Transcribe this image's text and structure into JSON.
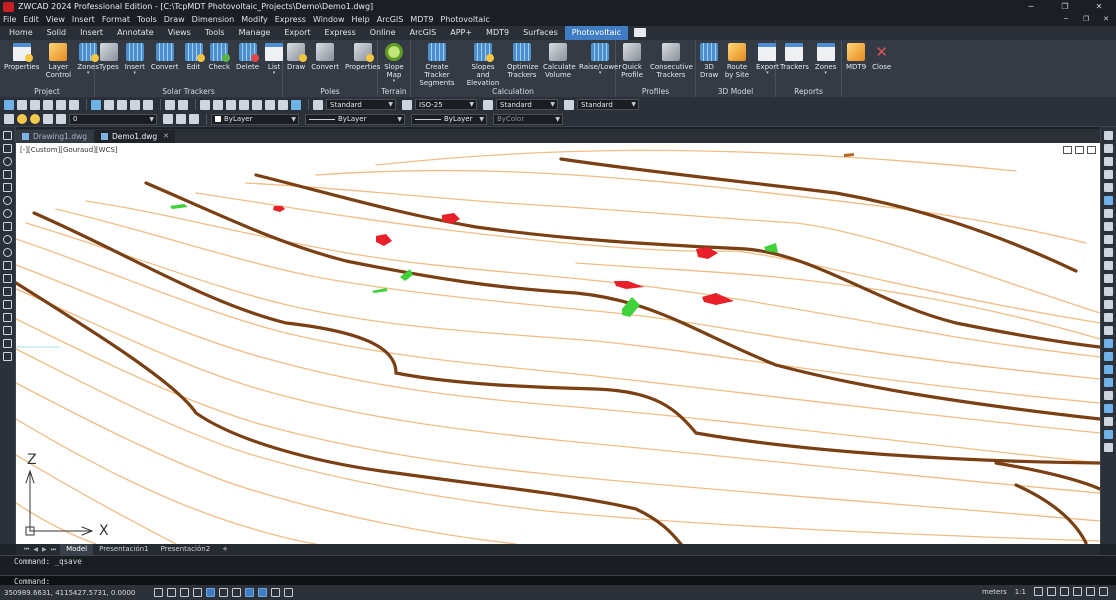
{
  "window": {
    "title": "ZWCAD 2024 Professional Edition - [C:\\TcpMDT Photovoltaic_Projects\\Demo\\Demo1.dwg]",
    "minimize": "─",
    "maximize": "❐",
    "close": "✕"
  },
  "menu": [
    "File",
    "Edit",
    "View",
    "Insert",
    "Format",
    "Tools",
    "Draw",
    "Dimension",
    "Modify",
    "Express",
    "Window",
    "Help",
    "ArcGIS",
    "MDT9",
    "Photovoltaic"
  ],
  "ribbon_tabs": [
    "Home",
    "Solid",
    "Insert",
    "Annotate",
    "Views",
    "Tools",
    "Manage",
    "Export",
    "Express",
    "Online",
    "ArcGIS",
    "APP+",
    "MDT9",
    "Surfaces",
    "Photovoltaic"
  ],
  "active_ribbon_tab": "Photovoltaic",
  "ribbon": {
    "project": {
      "label": "Project",
      "buttons": [
        "Properties",
        "Layer Control",
        "Zones"
      ]
    },
    "trackers": {
      "label": "Solar Trackers",
      "buttons": [
        "Types",
        "Insert",
        "Convert",
        "Edit",
        "Check",
        "Delete",
        "List"
      ]
    },
    "poles": {
      "label": "Poles",
      "buttons": [
        "Draw",
        "Convert",
        "Properties"
      ]
    },
    "terrain": {
      "label": "Terrain",
      "buttons": [
        "Slope Map"
      ]
    },
    "calculation": {
      "label": "Calculation",
      "buttons": [
        "Create Tracker Segments",
        "Slopes and Elevation",
        "Optimize Trackers",
        "Calculate Volume",
        "Raise/Lower"
      ]
    },
    "profiles": {
      "label": "Profiles",
      "buttons": [
        "Quick Profile",
        "Consecutive Trackers"
      ]
    },
    "model3d": {
      "label": "3D Model",
      "buttons": [
        "3D Draw",
        "Route by Site",
        "Export"
      ]
    },
    "reports": {
      "label": "Reports",
      "buttons": [
        "Trackers",
        "Zones"
      ]
    },
    "extra": {
      "buttons": [
        "MDT9",
        "Close"
      ]
    }
  },
  "toolbar": {
    "text_style": "Standard",
    "dim_style": "ISO-25",
    "table_style": "Standard",
    "mleader_style": "Standard",
    "layer": "0",
    "color": "ByLayer",
    "linetype": "ByLayer",
    "lineweight": "ByLayer",
    "plotstyle": "ByColor"
  },
  "doc_tabs": [
    {
      "name": "Drawing1.dwg",
      "active": false
    },
    {
      "name": "Demo1.dwg",
      "active": true
    }
  ],
  "viewport": {
    "label": "[-][Custom][Gouraud][WCS]",
    "axis_x": "X",
    "axis_z": "Z"
  },
  "layout_tabs": [
    {
      "name": "Model",
      "active": true
    },
    {
      "name": "Presentación1",
      "active": false
    },
    {
      "name": "Presentación2",
      "active": false
    },
    {
      "name": "+",
      "active": false
    }
  ],
  "command": {
    "history": "Command: _qsave",
    "prompt": "Command:"
  },
  "status": {
    "coords": "350989.6631, 4115427.5731, 0.0000",
    "units": "meters",
    "scale": "1:1"
  },
  "colors": {
    "ribbon_active": "#3f7cc4",
    "contour_major": "#7a3f12",
    "contour_minor": "#f0bd84",
    "pile_red": "#e8202a",
    "pile_green": "#3fd23a"
  }
}
